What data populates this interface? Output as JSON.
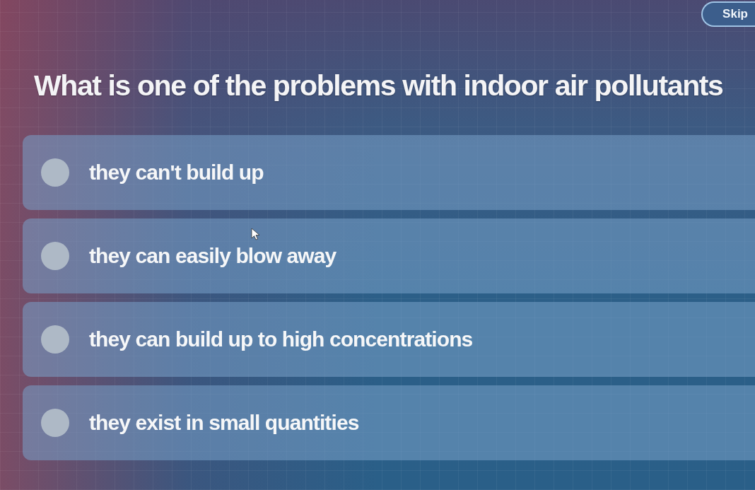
{
  "skip_button": {
    "label": "Skip"
  },
  "question": "What is one of the problems with indoor air pollutants",
  "options": [
    {
      "label": "they can't build up",
      "selected": false
    },
    {
      "label": "they can easily blow away",
      "selected": false
    },
    {
      "label": "they can build up to high concentrations",
      "selected": false
    },
    {
      "label": "they exist in small quantities",
      "selected": false
    }
  ]
}
